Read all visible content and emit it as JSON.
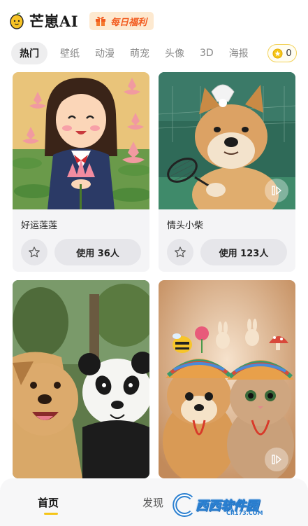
{
  "header": {
    "app_title": "芒崽AI",
    "daily_badge": "每日福利",
    "logo_icon": "mango-icon",
    "badge_icon": "gift-icon"
  },
  "tabs": [
    {
      "label": "热门",
      "active": true
    },
    {
      "label": "壁纸",
      "active": false
    },
    {
      "label": "动漫",
      "active": false
    },
    {
      "label": "萌宠",
      "active": false
    },
    {
      "label": "头像",
      "active": false
    },
    {
      "label": "3D",
      "active": false
    },
    {
      "label": "海报",
      "active": false
    }
  ],
  "coins": {
    "count": "0",
    "icon": "coin-icon"
  },
  "cards": [
    {
      "title": "好运莲莲",
      "use_label": "使用 36人",
      "image": "cartoon girl holding lotus",
      "video": false
    },
    {
      "title": "情头小柴",
      "use_label": "使用 123人",
      "image": "shiba with badminton racket",
      "video": true
    },
    {
      "title": "",
      "use_label": "",
      "image": "dog and panda selfie",
      "video": false
    },
    {
      "title": "",
      "use_label": "",
      "image": "shiba and cat in knitted hats",
      "video": true
    }
  ],
  "bottom_nav": {
    "home": "首页",
    "discover": "发现"
  },
  "watermark": {
    "text": "西西软件园",
    "url": "CR173.COM"
  },
  "colors": {
    "accent": "#f5c518",
    "badge_text": "#f25a1e",
    "badge_bg": "#fde9d0",
    "card_bg": "#f4f4f6"
  }
}
